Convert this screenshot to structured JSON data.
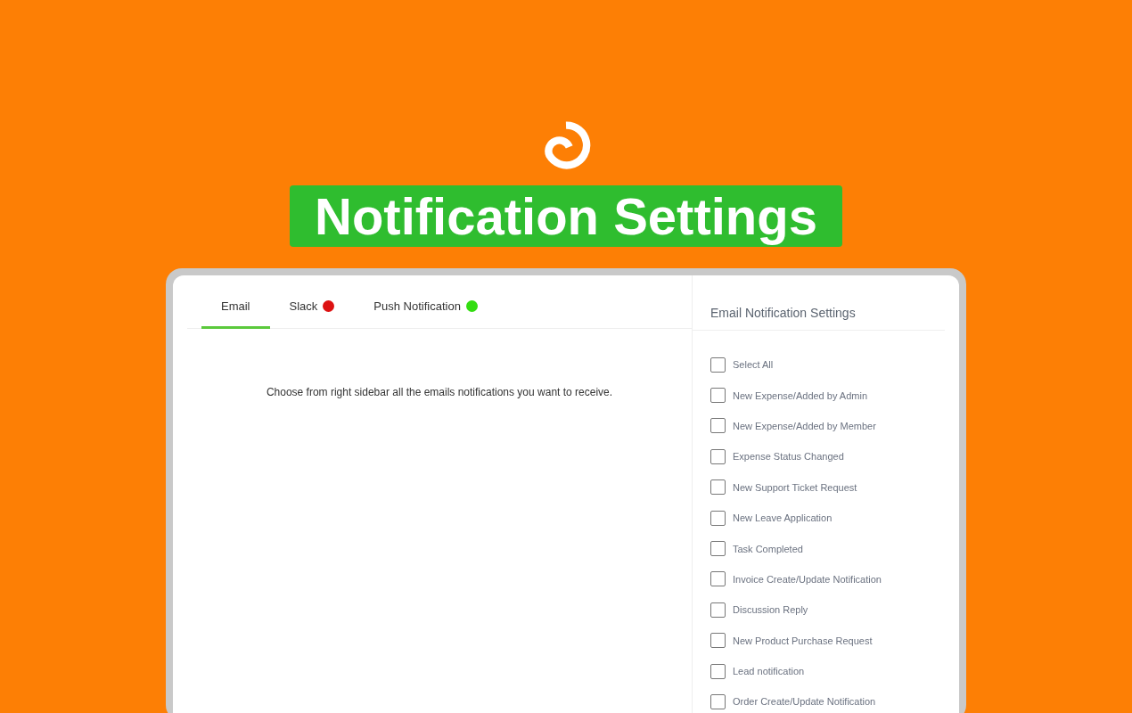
{
  "title": "Notification Settings",
  "tabs": [
    {
      "label": "Email",
      "selected": true
    },
    {
      "label": "Slack",
      "selected": false,
      "color": "#dd1111"
    },
    {
      "label": "Push Notification",
      "selected": false,
      "color": "#33dd11"
    }
  ],
  "message": "Choose from right sidebar all the emails notifications you want to receive.",
  "sidebar": {
    "title": "Email Notification Settings",
    "options": [
      {
        "label": "Select All",
        "checked": false
      },
      {
        "label": "New Expense/Added by Admin",
        "checked": false
      },
      {
        "label": "New Expense/Added by Member",
        "checked": false
      },
      {
        "label": "Expense Status Changed",
        "checked": false
      },
      {
        "label": "New Support Ticket Request",
        "checked": false
      },
      {
        "label": "New Leave Application",
        "checked": false
      },
      {
        "label": "Task Completed",
        "checked": false
      },
      {
        "label": "Invoice Create/Update Notification",
        "checked": false
      },
      {
        "label": "Discussion Reply",
        "checked": false
      },
      {
        "label": "New Product Purchase Request",
        "checked": false
      },
      {
        "label": "Lead notification",
        "checked": false
      },
      {
        "label": "Order Create/Update Notification",
        "checked": false
      }
    ]
  }
}
